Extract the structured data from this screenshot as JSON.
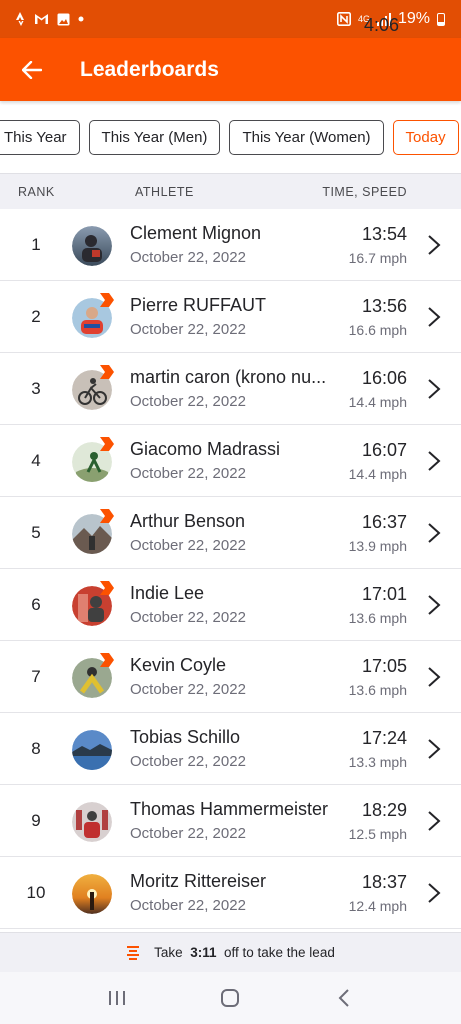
{
  "status_bar": {
    "time": "4:06",
    "battery": "19%",
    "network": "4G",
    "icons": [
      "strava-icon",
      "gmail-icon",
      "gallery-icon",
      "dot-icon",
      "nfc-icon",
      "signal-icon",
      "battery-icon"
    ]
  },
  "app_bar": {
    "title": "Leaderboards",
    "back_icon": "arrow-left-icon"
  },
  "filters": {
    "chips": [
      {
        "label": "This Year",
        "active": false
      },
      {
        "label": "This Year (Men)",
        "active": false
      },
      {
        "label": "This Year (Women)",
        "active": false
      },
      {
        "label": "Today",
        "active": true
      }
    ]
  },
  "table_header": {
    "rank": "RANK",
    "athlete": "ATHLETE",
    "time_speed": "TIME, SPEED"
  },
  "entries": [
    {
      "rank": "1",
      "name": "Clement Mignon",
      "date": "October 22, 2022",
      "time": "13:54",
      "speed": "16.7 mph",
      "badge": false
    },
    {
      "rank": "2",
      "name": "Pierre RUFFAUT",
      "date": "October 22, 2022",
      "time": "13:56",
      "speed": "16.6 mph",
      "badge": true
    },
    {
      "rank": "3",
      "name": "martin caron (krono nu...",
      "date": "October 22, 2022",
      "time": "16:06",
      "speed": "14.4 mph",
      "badge": true
    },
    {
      "rank": "4",
      "name": "Giacomo Madrassi",
      "date": "October 22, 2022",
      "time": "16:07",
      "speed": "14.4 mph",
      "badge": true
    },
    {
      "rank": "5",
      "name": "Arthur Benson",
      "date": "October 22, 2022",
      "time": "16:37",
      "speed": "13.9 mph",
      "badge": true
    },
    {
      "rank": "6",
      "name": "Indie Lee",
      "date": "October 22, 2022",
      "time": "17:01",
      "speed": "13.6 mph",
      "badge": true
    },
    {
      "rank": "7",
      "name": "Kevin Coyle",
      "date": "October 22, 2022",
      "time": "17:05",
      "speed": "13.6 mph",
      "badge": true
    },
    {
      "rank": "8",
      "name": "Tobias Schillo",
      "date": "October 22, 2022",
      "time": "17:24",
      "speed": "13.3 mph",
      "badge": false
    },
    {
      "rank": "9",
      "name": "Thomas Hammermeister",
      "date": "October 22, 2022",
      "time": "18:29",
      "speed": "12.5 mph",
      "badge": false
    },
    {
      "rank": "10",
      "name": "Moritz Rittereiser",
      "date": "October 22, 2022",
      "time": "18:37",
      "speed": "12.4 mph",
      "badge": false
    }
  ],
  "footer": {
    "prefix": "Take ",
    "gap": "3:11",
    "suffix": " off to take the lead"
  },
  "colors": {
    "brand": "#fc5200",
    "status_bar": "#e24e04"
  }
}
